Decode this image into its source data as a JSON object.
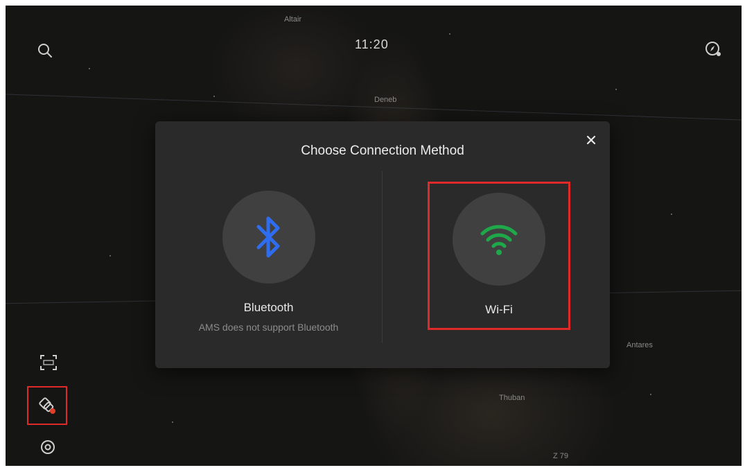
{
  "status_bar": {
    "time": "11:20"
  },
  "sky_labels": [
    "Altair",
    "Deneb",
    "Antares",
    "Thuban",
    "Z 79"
  ],
  "dialog": {
    "title": "Choose Connection Method",
    "options": [
      {
        "label": "Bluetooth",
        "note": "AMS does not support Bluetooth",
        "icon": "bluetooth-icon"
      },
      {
        "label": "Wi-Fi",
        "icon": "wifi-icon"
      }
    ]
  },
  "colors": {
    "bluetooth": "#2f6df0",
    "wifi": "#1fa84a",
    "highlight": "#e02a2a",
    "modal": "#2a2a2a"
  }
}
